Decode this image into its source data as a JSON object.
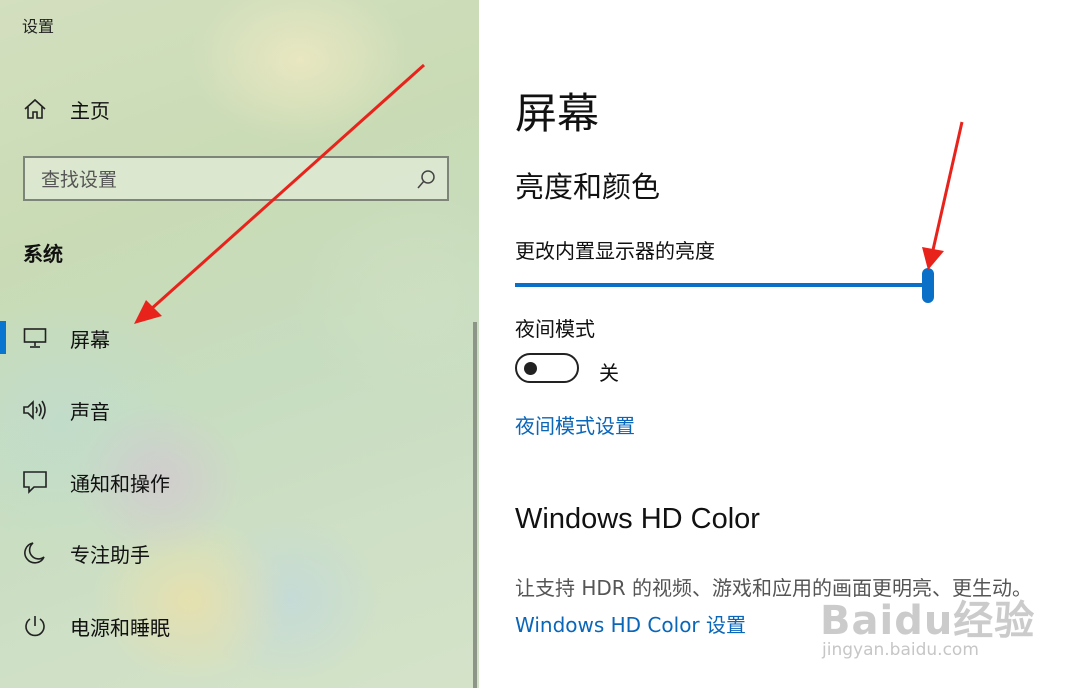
{
  "app": {
    "title": "设置"
  },
  "sidebar": {
    "home_label": "主页",
    "search": {
      "placeholder": "查找设置"
    },
    "section_header": "系统",
    "items": [
      {
        "label": "屏幕",
        "icon": "monitor-icon",
        "selected": true
      },
      {
        "label": "声音",
        "icon": "speaker-icon"
      },
      {
        "label": "通知和操作",
        "icon": "message-icon"
      },
      {
        "label": "专注助手",
        "icon": "moon-icon"
      },
      {
        "label": "电源和睡眠",
        "icon": "power-icon"
      }
    ]
  },
  "main": {
    "page_title": "屏幕",
    "brightness_section_title": "亮度和颜色",
    "brightness_label": "更改内置显示器的亮度",
    "brightness_level": 1.0,
    "night_mode_label": "夜间模式",
    "night_mode_state": "关",
    "night_mode_on": false,
    "night_mode_settings_link": "夜间模式设置",
    "hd_color_title": "Windows HD Color",
    "hd_color_description": "让支持 HDR 的视频、游戏和应用的画面更明亮、更生动。",
    "hd_color_settings_link": "Windows HD Color 设置"
  },
  "watermark": {
    "logo_text": "Baidu经验",
    "url": "jingyan.baidu.com"
  },
  "colors": {
    "accent": "#0a6fc6",
    "link": "#0a66b8",
    "annotation_arrow": "#e8231c"
  }
}
